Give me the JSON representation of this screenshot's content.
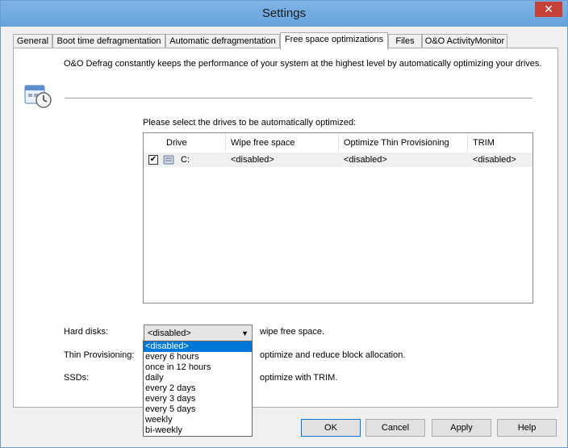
{
  "window": {
    "title": "Settings",
    "close_glyph": "✕"
  },
  "tabs": [
    {
      "label": "General"
    },
    {
      "label": "Boot time defragmentation"
    },
    {
      "label": "Automatic defragmentation"
    },
    {
      "label": "Free space optimizations"
    },
    {
      "label": "Files"
    },
    {
      "label": "O&O ActivityMonitor"
    }
  ],
  "active_tab": 3,
  "panel": {
    "intro": "O&O Defrag constantly keeps the performance of your system at the highest level by automatically optimizing your drives.",
    "select_label": "Please select the drives to be automatically optimized:",
    "icon": "calendar-clock-icon"
  },
  "drives_table": {
    "columns": [
      "Drive",
      "Wipe free space",
      "Optimize Thin Provisioning",
      "TRIM"
    ],
    "rows": [
      {
        "checked": true,
        "check_glyph": "✔",
        "drive": "C:",
        "wipe": "<disabled>",
        "thin": "<disabled>",
        "trim": "<disabled>"
      }
    ]
  },
  "settings": {
    "hard_disks_label": "Hard disks:",
    "hard_disks_value": "<disabled>",
    "hard_disks_suffix": "wipe free space.",
    "thin_label": "Thin Provisioning:",
    "thin_suffix": "optimize and reduce block allocation.",
    "ssd_label": "SSDs:",
    "ssd_suffix": "optimize with TRIM."
  },
  "dropdown": {
    "open": true,
    "options": [
      "<disabled>",
      "every 6 hours",
      "once in 12 hours",
      "daily",
      "every 2 days",
      "every 3 days",
      "every 5 days",
      "weekly",
      "bi-weekly"
    ],
    "selected_index": 0
  },
  "buttons": {
    "ok": "OK",
    "cancel": "Cancel",
    "apply": "Apply",
    "help": "Help"
  },
  "colors": {
    "title_bar": "#6fa8dc",
    "selection": "#0078d7",
    "close": "#c7413a"
  }
}
